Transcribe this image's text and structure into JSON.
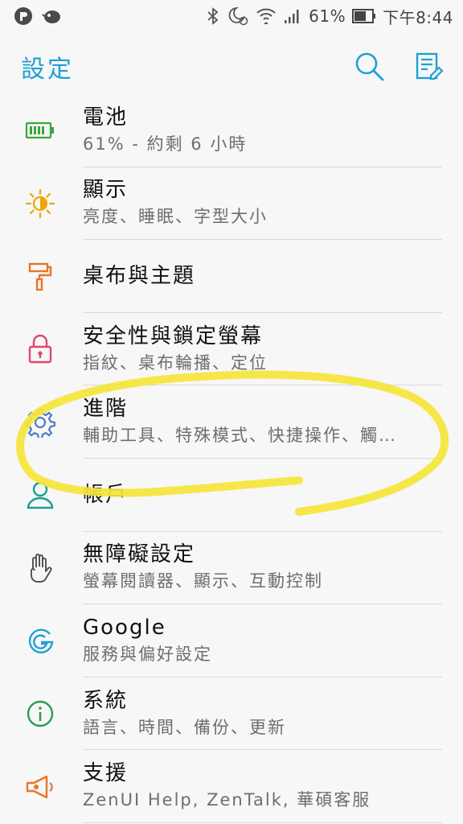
{
  "status_bar": {
    "battery_percent": "61%",
    "time": "下午8:44"
  },
  "header": {
    "title": "設定"
  },
  "settings": [
    {
      "icon": "battery-icon",
      "title": "電池",
      "subtitle": "61% - 約剩 6 小時"
    },
    {
      "icon": "brightness-icon",
      "title": "顯示",
      "subtitle": "亮度、睡眠、字型大小"
    },
    {
      "icon": "paint-roller-icon",
      "title": "桌布與主題",
      "subtitle": ""
    },
    {
      "icon": "lock-icon",
      "title": "安全性與鎖定螢幕",
      "subtitle": "指紋、桌布輪播、定位"
    },
    {
      "icon": "gear-icon",
      "title": "進階",
      "subtitle": "輔助工具、特殊模式、快捷操作、觸…"
    },
    {
      "icon": "person-icon",
      "title": "帳戶",
      "subtitle": ""
    },
    {
      "icon": "hand-icon",
      "title": "無障礙設定",
      "subtitle": "螢幕閱讀器、顯示、互動控制"
    },
    {
      "icon": "google-icon",
      "title": "Google",
      "subtitle": "服務與偏好設定"
    },
    {
      "icon": "info-icon",
      "title": "系統",
      "subtitle": "語言、時間、備份、更新"
    },
    {
      "icon": "megaphone-icon",
      "title": "支援",
      "subtitle": "ZenUI Help, ZenTalk, 華碩客服"
    }
  ],
  "colors": {
    "accent": "#1e9fd6",
    "battery": "#3aa63a",
    "brightness": "#f0a500",
    "theme": "#e8752a",
    "security": "#e0466c",
    "advanced": "#4a7fc1",
    "account": "#1aa08e",
    "google": "#1e9fd6",
    "system": "#2e9b52",
    "support": "#e8752a",
    "marker": "#f5e53a"
  }
}
